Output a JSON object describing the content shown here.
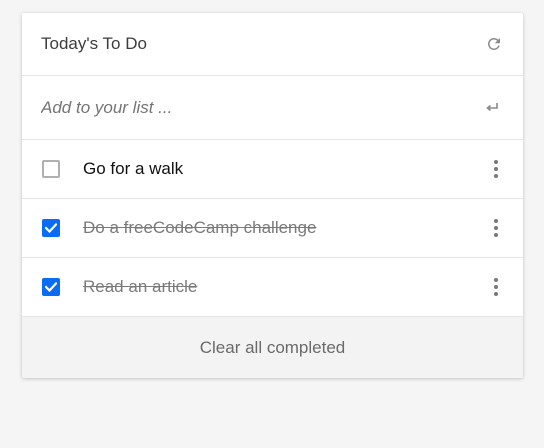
{
  "header": {
    "title": "Today's To Do",
    "refresh_icon": "refresh-icon"
  },
  "add": {
    "placeholder": "Add to your list ...",
    "enter_icon": "enter-icon"
  },
  "items": [
    {
      "label": "Go for a walk",
      "completed": false
    },
    {
      "label": "Do a freeCodeCamp challenge",
      "completed": true
    },
    {
      "label": "Read an article",
      "completed": true
    }
  ],
  "footer": {
    "clear_label": "Clear all completed"
  },
  "colors": {
    "accent": "#0a6cf5",
    "background": "#f5f5f5",
    "footer_bg": "#f3f3f3"
  }
}
